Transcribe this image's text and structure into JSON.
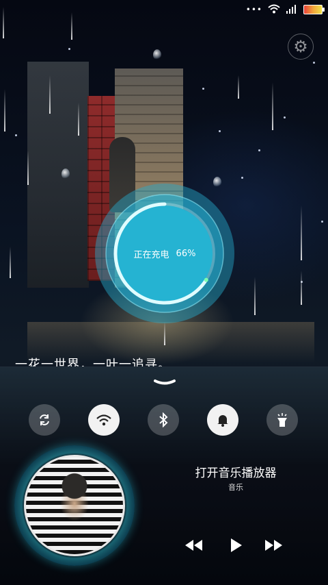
{
  "status": {
    "dots": "•••",
    "wifi_icon": "wifi-icon",
    "signal_icon": "signal-icon",
    "battery_icon": "battery-icon"
  },
  "settings": {
    "icon": "gear-icon"
  },
  "charging": {
    "label": "正在充电",
    "percent_text": "66%",
    "percent_value": 66,
    "accent": "#27b8d6"
  },
  "quote": "一花一世界，一叶一追寻。",
  "panel": {
    "handle_icon": "chevron-down-icon",
    "toggles": [
      {
        "name": "sync",
        "icon": "sync-icon",
        "on": false
      },
      {
        "name": "wifi",
        "icon": "wifi-icon",
        "on": true
      },
      {
        "name": "bluetooth",
        "icon": "bluetooth-icon",
        "on": false
      },
      {
        "name": "sound",
        "icon": "bell-icon",
        "on": true
      },
      {
        "name": "flashlight",
        "icon": "flashlight-icon",
        "on": false
      }
    ]
  },
  "music": {
    "title": "打开音乐播放器",
    "subtitle": "音乐",
    "controls": [
      "previous-icon",
      "play-icon",
      "next-icon"
    ]
  }
}
